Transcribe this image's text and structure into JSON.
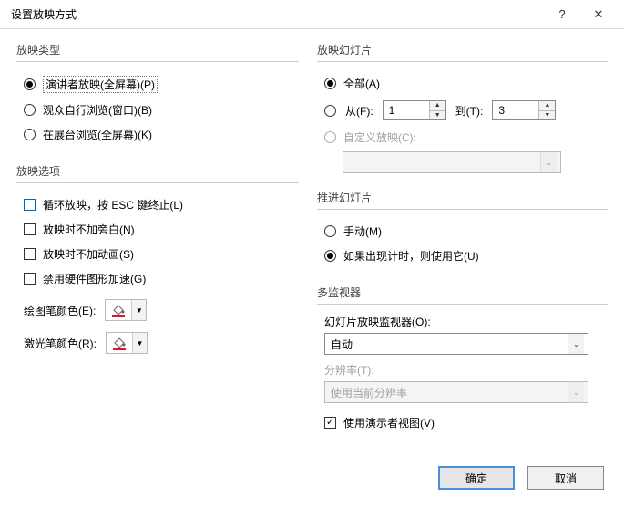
{
  "title": "设置放映方式",
  "groups": {
    "showType": {
      "title": "放映类型",
      "opt_presenter": "演讲者放映(全屏幕)(P)",
      "opt_browse": "观众自行浏览(窗口)(B)",
      "opt_kiosk": "在展台浏览(全屏幕)(K)"
    },
    "showOptions": {
      "title": "放映选项",
      "loop": "循环放映，按 ESC 键终止(L)",
      "no_narration": "放映时不加旁白(N)",
      "no_animation": "放映时不加动画(S)",
      "disable_hw": "禁用硬件图形加速(G)",
      "pen_color_label": "绘图笔颜色(E):",
      "laser_color_label": "激光笔颜色(R):"
    },
    "slides": {
      "title": "放映幻灯片",
      "all": "全部(A)",
      "from_label": "从(F):",
      "to_label": "到(T):",
      "from_value": "1",
      "to_value": "3",
      "custom": "自定义放映(C):",
      "custom_value": ""
    },
    "advance": {
      "title": "推进幻灯片",
      "manual": "手动(M)",
      "timings": "如果出现计时，则使用它(U)"
    },
    "monitors": {
      "title": "多监视器",
      "monitor_label": "幻灯片放映监视器(O):",
      "monitor_value": "自动",
      "resolution_label": "分辨率(T):",
      "resolution_value": "使用当前分辨率",
      "presenter_view": "使用演示者视图(V)"
    }
  },
  "buttons": {
    "ok": "确定",
    "cancel": "取消"
  }
}
